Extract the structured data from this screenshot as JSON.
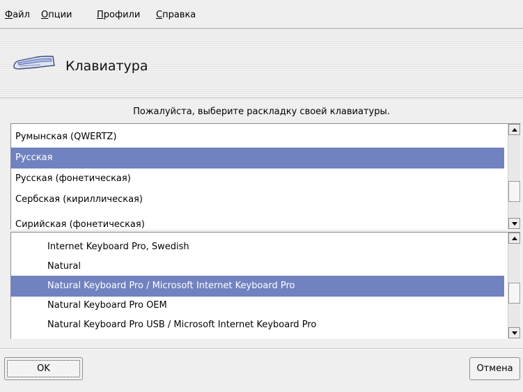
{
  "menu": {
    "file": {
      "accel": "Ф",
      "rest": "айл"
    },
    "options": {
      "accel": "О",
      "rest": "пции"
    },
    "profiles": {
      "accel": "П",
      "rest": "рофили"
    },
    "help": {
      "accel": "С",
      "rest": "правка"
    }
  },
  "banner": {
    "title": "Клавиатура",
    "icon": "keyboard-icon"
  },
  "prompt": "Пожалуйста, выберите раскладку своей клавиатуры.",
  "layouts": {
    "items": [
      "Румынская (QWERTZ)",
      "Русская",
      "Русская (фонетическая)",
      "Сербская (кириллическая)",
      "Сирийская (фонетическая)"
    ],
    "selected": "Русская"
  },
  "models": {
    "items": [
      "Internet Keyboard Pro, Swedish",
      "Natural",
      "Natural Keyboard Pro / Microsoft Internet Keyboard Pro",
      "Natural Keyboard Pro OEM",
      "Natural Keyboard Pro USB / Microsoft Internet Keyboard Pro"
    ],
    "selected": "Natural Keyboard Pro / Microsoft Internet Keyboard Pro"
  },
  "buttons": {
    "ok": "OK",
    "cancel": "Отмена"
  },
  "colors": {
    "selection": "#7182c0",
    "background": "#efefef"
  }
}
